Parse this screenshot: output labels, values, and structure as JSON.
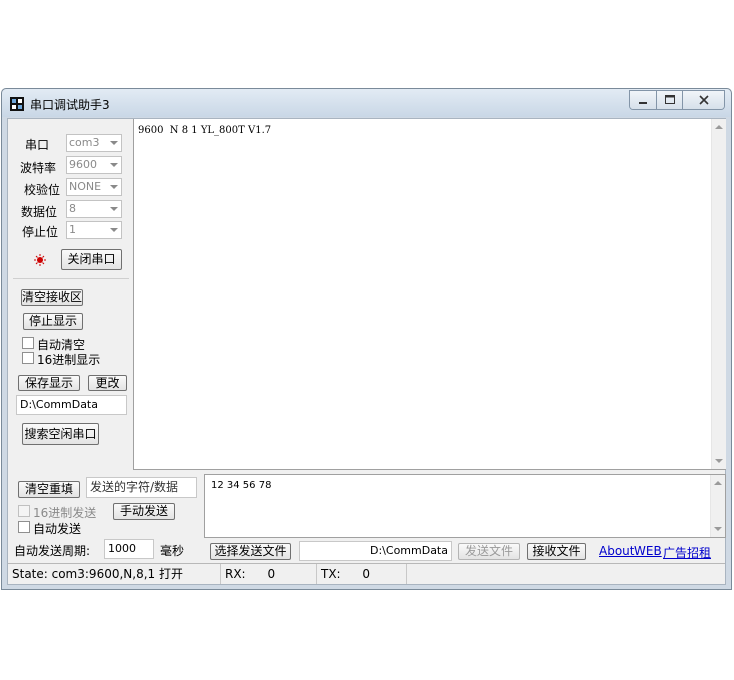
{
  "window": {
    "title": "串口调试助手3"
  },
  "settings": {
    "port_label": "串口",
    "port_value": "com3",
    "baud_label": "波特率",
    "baud_value": "9600",
    "parity_label": "校验位",
    "parity_value": "NONE",
    "databits_label": "数据位",
    "databits_value": "8",
    "stopbits_label": "停止位",
    "stopbits_value": "1",
    "close_port_button": "关闭串口"
  },
  "receive_panel": {
    "clear_button": "清空接收区",
    "stop_display_button": "停止显示",
    "auto_clear_label": "自动清空",
    "hex_display_label": "16进制显示",
    "save_display_button": "保存显示",
    "change_button": "更改",
    "save_path": "D:\\CommData",
    "search_port_button": "搜索空闲串口"
  },
  "receive_area": {
    "content": "9600  N 8 1 YL_800T V1.7"
  },
  "send_panel": {
    "clear_resend_button": "清空重填",
    "send_input_placeholder": "发送的字符/数据",
    "hex_send_label": "16进制发送",
    "manual_send_button": "手动发送",
    "auto_send_label": "自动发送",
    "auto_period_label": "自动发送周期:",
    "auto_period_value": "1000",
    "ms_label": "毫秒"
  },
  "send_area": {
    "content": "12 34 56 78"
  },
  "file_bar": {
    "choose_file_button": "选择发送文件",
    "file_path": "D:\\CommData",
    "send_file_button": "发送文件",
    "receive_file_button": "接收文件",
    "about_link": "About",
    "web_link": "WEB",
    "ads_link": "广告招租"
  },
  "status_bar": {
    "state": "State: com3:9600,N,8,1 打开",
    "rx_label": "RX:",
    "rx_value": "0",
    "tx_label": "TX:",
    "tx_value": "0"
  },
  "colors": {
    "link": "#0000cc",
    "indicator": "#cc0000",
    "titlebar": "#c9d7e6"
  },
  "icons": [
    "app-icon",
    "minimize-icon",
    "maximize-icon",
    "close-icon",
    "indicator-icon"
  ]
}
